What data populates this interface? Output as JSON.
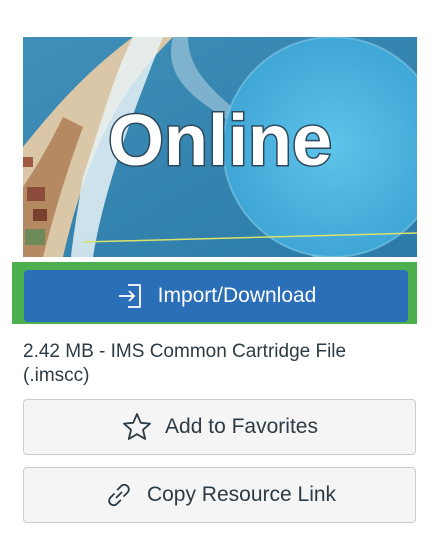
{
  "thumbnail": {
    "text": "Online"
  },
  "import_button": {
    "label": "Import/Download",
    "icon": "import-icon",
    "color": "#2a6fb8"
  },
  "highlight": {
    "color": "#4caf50"
  },
  "file_info": {
    "text": "2.42 MB - IMS Common Cartridge File (.imscc)"
  },
  "favorites_button": {
    "label": "Add to Favorites",
    "icon": "star-icon"
  },
  "copy_link_button": {
    "label": "Copy Resource Link",
    "icon": "link-icon"
  }
}
